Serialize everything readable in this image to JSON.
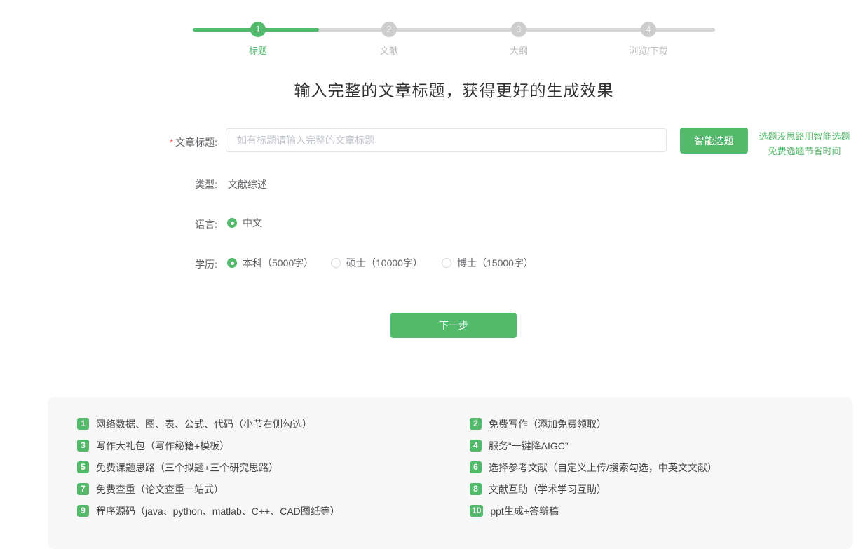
{
  "colors": {
    "accent_green": "#53b96b",
    "inactive_gray": "#cdcdcd",
    "required_red": "#f56c6c",
    "footer_background": "#f7f7f8"
  },
  "stepper": {
    "steps": [
      {
        "num": "1",
        "label": "标题",
        "state": "active"
      },
      {
        "num": "2",
        "label": "文献",
        "state": "upcoming"
      },
      {
        "num": "3",
        "label": "大纲",
        "state": "upcoming"
      },
      {
        "num": "4",
        "label": "浏览/下载",
        "state": "upcoming"
      }
    ]
  },
  "heading": "输入完整的文章标题，获得更好的生成效果",
  "form": {
    "title_row": {
      "required_mark": "*",
      "label": "文章标题:",
      "input_value": "",
      "placeholder": "如有标题请输入完整的文章标题",
      "button": "智能选题",
      "promo_line1": "选题没思路用智能选题",
      "promo_line2": "免费选题节省时间"
    },
    "type_row": {
      "label": "类型:",
      "value": "文献综述"
    },
    "language_row": {
      "label": "语言:",
      "options": [
        {
          "label": "中文",
          "checked": true
        }
      ]
    },
    "education_row": {
      "label": "学历:",
      "options": [
        {
          "label": "本科（5000字）",
          "checked": true
        },
        {
          "label": "硕士（10000字）",
          "checked": false
        },
        {
          "label": "博士（15000字）",
          "checked": false
        }
      ]
    },
    "next_button": "下一步"
  },
  "footer": {
    "items": [
      {
        "num": "1",
        "text": "网络数据、图、表、公式、代码（小节右侧勾选）"
      },
      {
        "num": "2",
        "text": "免费写作（添加免费领取）"
      },
      {
        "num": "3",
        "text": "写作大礼包（写作秘籍+模板）"
      },
      {
        "num": "4",
        "text": "服务“一键降AIGC”"
      },
      {
        "num": "5",
        "text": "免费课题思路（三个拟题+三个研究思路）"
      },
      {
        "num": "6",
        "text": "选择参考文献（自定义上传/搜索勾选，中英文文献）"
      },
      {
        "num": "7",
        "text": "免费查重（论文查重一站式）"
      },
      {
        "num": "8",
        "text": "文献互助（学术学习互助）"
      },
      {
        "num": "9",
        "text": "程序源码（java、python、matlab、C++、CAD图纸等）"
      },
      {
        "num": "10",
        "text": "ppt生成+答辩稿"
      }
    ]
  }
}
